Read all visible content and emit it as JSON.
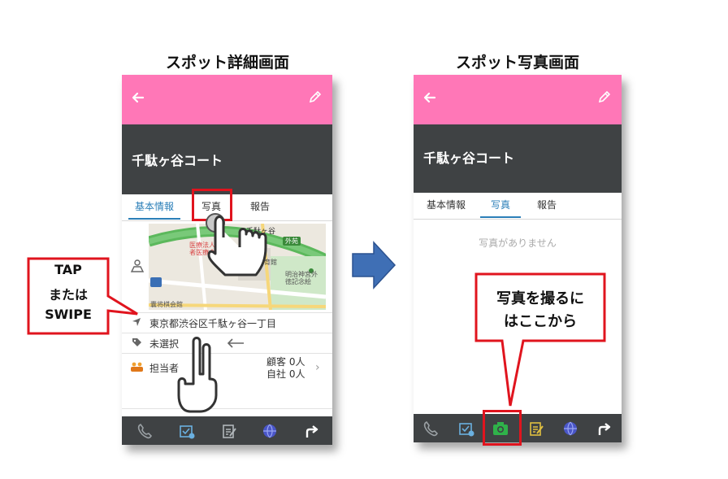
{
  "captions": {
    "left": "スポット詳細画面",
    "right": "スポット写真画面"
  },
  "colors": {
    "appbar": "#ff77b7",
    "titlebar": "#3f4244",
    "accent": "#2b7fb8",
    "highlight": "#e0141e",
    "arrow": "#3f6fb5"
  },
  "left_screen": {
    "appbar": {
      "back_icon": "back-arrow-icon",
      "edit_icon": "pencil-icon"
    },
    "title": "千駄ヶ谷コート",
    "tabs": [
      {
        "label": "基本情報",
        "active": true
      },
      {
        "label": "写真",
        "active": false
      },
      {
        "label": "報告",
        "active": false
      }
    ],
    "map_labels": {
      "sendagaya": "千駄ヶ谷",
      "gaien": "外苑",
      "hospital": "医療法人財団\n者医療会",
      "gym": "体育館",
      "meiji": "明治神宮外\n徳記念絵",
      "shogi": "囊将棋会館"
    },
    "address": "東京都渋谷区千駄ヶ谷一丁目",
    "tag": "未選択",
    "person_label": "担当者",
    "counts": {
      "customer": "顧客 0人",
      "own": "自社 0人"
    }
  },
  "right_screen": {
    "title": "千駄ヶ谷コート",
    "tabs": [
      {
        "label": "基本情報",
        "active": false
      },
      {
        "label": "写真",
        "active": true
      },
      {
        "label": "報告",
        "active": false
      }
    ],
    "empty_message": "写真がありません"
  },
  "callouts": {
    "tap": {
      "line1": "TAP",
      "line2": "または",
      "line3": "SWIPE"
    },
    "camera": {
      "line1": "写真を撮るに",
      "line2": "はここから"
    }
  },
  "bottom_icons": [
    "phone-icon",
    "calendar-check-icon",
    "note-edit-icon",
    "globe-icon",
    "share-arrow-icon"
  ],
  "right_bottom_icons": [
    "phone-icon",
    "calendar-check-icon",
    "camera-icon",
    "note-edit-icon",
    "globe-icon",
    "share-arrow-icon"
  ]
}
